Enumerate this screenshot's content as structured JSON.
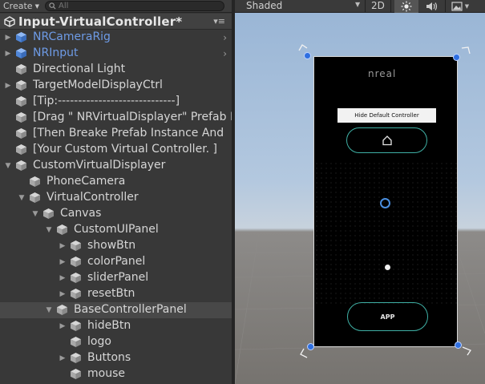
{
  "hierarchy": {
    "create_label": "Create",
    "search_placeholder": "All",
    "scene_title": "Input-VirtualController*",
    "menu_glyph": "▾≡",
    "items": [
      {
        "label": "NRCameraRig",
        "depth": 0,
        "expand": "collapsed",
        "blue": true,
        "chevron": true
      },
      {
        "label": "NRInput",
        "depth": 0,
        "expand": "collapsed",
        "blue": true,
        "chevron": true
      },
      {
        "label": "Directional Light",
        "depth": 0,
        "expand": "none",
        "blue": false,
        "chevron": false
      },
      {
        "label": "TargetModelDisplayCtrl",
        "depth": 0,
        "expand": "collapsed",
        "blue": false,
        "chevron": false
      },
      {
        "label": "[Tip:-----------------------------]",
        "depth": 0,
        "expand": "none",
        "blue": false,
        "chevron": false
      },
      {
        "label": "[Drag \" NRVirtualDisplayer\" Prefab I",
        "depth": 0,
        "expand": "none",
        "blue": false,
        "chevron": false
      },
      {
        "label": "[Then Breake Prefab Instance And",
        "depth": 0,
        "expand": "none",
        "blue": false,
        "chevron": false
      },
      {
        "label": "[Your Custom Virtual Controller. ]",
        "depth": 0,
        "expand": "none",
        "blue": false,
        "chevron": false
      },
      {
        "label": "CustomVirtualDisplayer",
        "depth": 0,
        "expand": "expanded",
        "blue": false,
        "chevron": false
      },
      {
        "label": "PhoneCamera",
        "depth": 1,
        "expand": "none",
        "blue": false,
        "chevron": false
      },
      {
        "label": "VirtualController",
        "depth": 1,
        "expand": "expanded",
        "blue": false,
        "chevron": false
      },
      {
        "label": "Canvas",
        "depth": 2,
        "expand": "expanded",
        "blue": false,
        "chevron": false
      },
      {
        "label": "CustomUIPanel",
        "depth": 3,
        "expand": "expanded",
        "blue": false,
        "chevron": false
      },
      {
        "label": "showBtn",
        "depth": 4,
        "expand": "collapsed",
        "blue": false,
        "chevron": false
      },
      {
        "label": "colorPanel",
        "depth": 4,
        "expand": "collapsed",
        "blue": false,
        "chevron": false
      },
      {
        "label": "sliderPanel",
        "depth": 4,
        "expand": "collapsed",
        "blue": false,
        "chevron": false
      },
      {
        "label": "resetBtn",
        "depth": 4,
        "expand": "collapsed",
        "blue": false,
        "chevron": false
      },
      {
        "label": "BaseControllerPanel",
        "depth": 3,
        "expand": "expanded",
        "blue": false,
        "chevron": false,
        "selected": true
      },
      {
        "label": "hideBtn",
        "depth": 4,
        "expand": "collapsed",
        "blue": false,
        "chevron": false
      },
      {
        "label": "logo",
        "depth": 4,
        "expand": "none",
        "blue": false,
        "chevron": false
      },
      {
        "label": "Buttons",
        "depth": 4,
        "expand": "collapsed",
        "blue": false,
        "chevron": false
      },
      {
        "label": "mouse",
        "depth": 4,
        "expand": "none",
        "blue": false,
        "chevron": false
      }
    ]
  },
  "scene": {
    "shading_mode": "Shaded",
    "mode_2d": "2D",
    "phone": {
      "logo_text": "nreal",
      "hide_default_label": "Hide Default Controller",
      "app_label": "APP"
    }
  },
  "colors": {
    "accent_teal": "#3fb0a5",
    "handle_blue": "#2f6fe0",
    "prefab_blue": "#6e9be6"
  }
}
